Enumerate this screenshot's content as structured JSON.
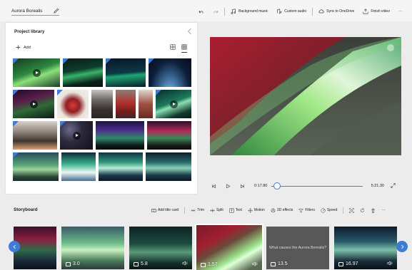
{
  "titlebar": {
    "project_title": "Aurora Borealis",
    "background_music": "Background music",
    "custom_audio": "Custom audio",
    "sync_onedrive": "Sync to OneDrive",
    "finish_video": "Finish video",
    "more": "···"
  },
  "library": {
    "title": "Project library",
    "add_label": "Add"
  },
  "player": {
    "current_time": "0:17.80",
    "total_time": "5:21.30",
    "progress": 0.056
  },
  "preview": {
    "watermark": ""
  },
  "storyboard": {
    "title": "Storyboard",
    "tools": {
      "add_title_card": "Add title card",
      "trim": "Trim",
      "split": "Split",
      "text": "Text",
      "motion": "Motion",
      "effects_3d": "3D effects",
      "filters": "Filters",
      "speed": "Speed",
      "more": "···"
    },
    "cards": [
      {
        "duration": ""
      },
      {
        "duration": "3.0"
      },
      {
        "duration": "5.8"
      },
      {
        "duration": "1.57"
      },
      {
        "duration": "13.5",
        "caption": "What causes the Aurora Borealis?"
      },
      {
        "duration": "16.97"
      }
    ]
  },
  "colors": {
    "accent": "#3d7bd6"
  }
}
